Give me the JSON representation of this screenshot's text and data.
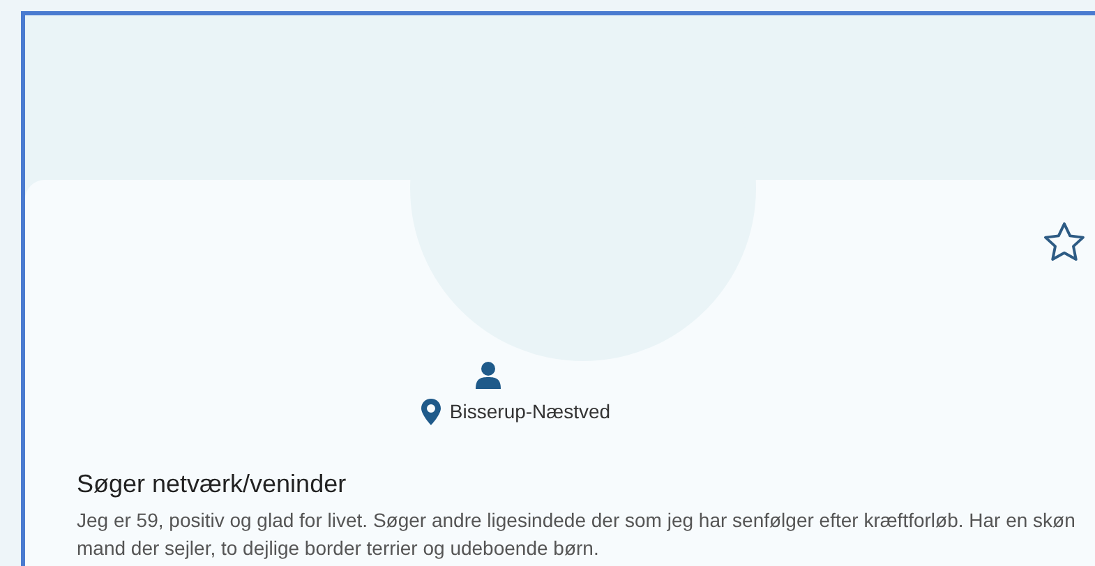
{
  "profile": {
    "favorite": false,
    "location": "Bisserup-Næstved",
    "heading": "Søger netværk/veninder",
    "description": "Jeg er 59, positiv og glad for livet. Søger andre ligesindede der som jeg har senfølger efter kræftforløb. Har en skøn mand der sejler, to dejlige border terrier og udeboende børn."
  }
}
